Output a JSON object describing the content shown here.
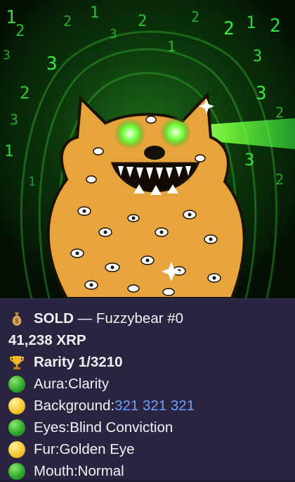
{
  "nft": {
    "status": "SOLD",
    "separator": "—",
    "name": "Fuzzybear #0",
    "price": "41,238 XRP",
    "rarity": "Rarity 1/3210",
    "status_icon": "money-bag-icon",
    "rarity_icon": "trophy-icon"
  },
  "traits": [
    {
      "label": "Aura: ",
      "value": "Clarity",
      "dot": "green"
    },
    {
      "label": "Background: ",
      "value": "321 321 321",
      "dot": "yellow",
      "is_link": true
    },
    {
      "label": "Eyes: ",
      "value": "Blind Conviction",
      "dot": "green"
    },
    {
      "label": "Fur: ",
      "value": "Golden Eye",
      "dot": "yellow"
    },
    {
      "label": "Mouth: ",
      "value": "Normal",
      "dot": "green"
    }
  ],
  "colors": {
    "background": "#231d35",
    "text": "#f2f2f6",
    "link": "#6fa1ff",
    "matrix_green": "#3cff46",
    "fur_gold": "#e7a43d"
  },
  "art": {
    "background_digits": [
      "1",
      "2",
      "3"
    ]
  }
}
